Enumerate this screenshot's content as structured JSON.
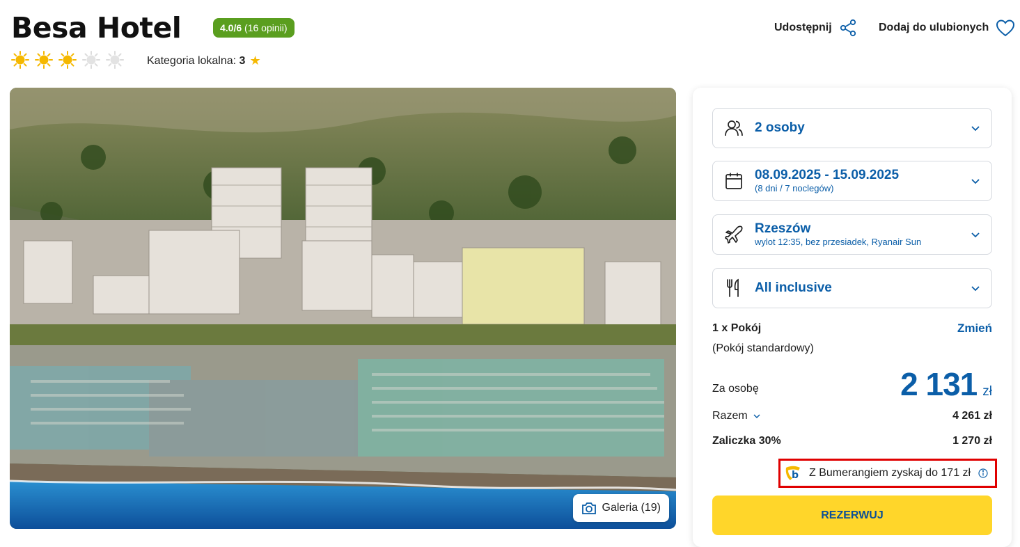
{
  "hotel": {
    "name": "Besa Hotel",
    "rating_score": "4.0/6",
    "rating_count": "(16 opinii)",
    "suns_filled": 3,
    "suns_total": 5,
    "category_label": "Kategoria lokalna:",
    "category_value": "3"
  },
  "actions": {
    "share_label": "Udostępnij",
    "favorite_label": "Dodaj do ulubionych"
  },
  "gallery": {
    "label": "Galeria (19)"
  },
  "booking": {
    "persons": "2 osoby",
    "dates": "08.09.2025 - 15.09.2025",
    "dates_sub": "(8 dni / 7 noclegów)",
    "departure_city": "Rzeszów",
    "departure_sub": "wylot 12:35, bez przesiadek, Ryanair Sun",
    "board": "All inclusive",
    "room_count": "1 x Pokój",
    "room_type": "(Pokój standardowy)",
    "change_label": "Zmień",
    "per_person_label": "Za osobę",
    "per_person_price": "2 131",
    "currency": "zł",
    "total_label": "Razem",
    "total_value": "4 261 zł",
    "deposit_label": "Zaliczka 30%",
    "deposit_value": "1 270 zł",
    "bumerang_text": "Z Bumerangiem zyskaj do 171 zł",
    "reserve_label": "REZERWUJ"
  },
  "colors": {
    "accent_blue": "#0b5ea8",
    "rating_green": "#5a9e1f",
    "reserve_yellow": "#ffd62a",
    "highlight_red": "#e00000"
  }
}
